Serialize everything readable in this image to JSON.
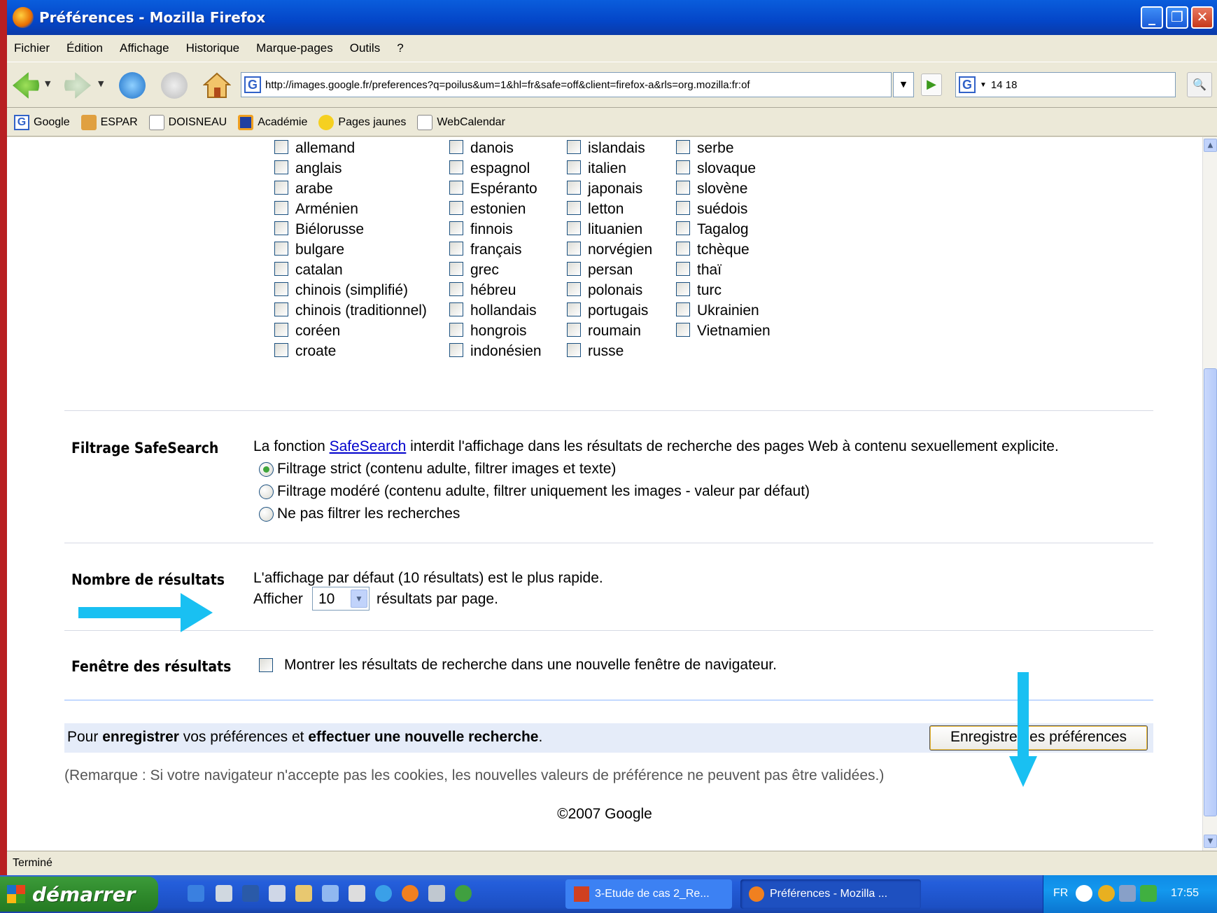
{
  "window": {
    "title": "Préférences - Mozilla Firefox"
  },
  "menu": [
    "Fichier",
    "Édition",
    "Affichage",
    "Historique",
    "Marque-pages",
    "Outils",
    "?"
  ],
  "nav": {
    "url": "http://images.google.fr/preferences?q=poilus&um=1&hl=fr&safe=off&client=firefox-a&rls=org.mozilla:fr:of",
    "search_value": "14 18"
  },
  "bookmarks": [
    "Google",
    "ESPAR",
    "DOISNEAU",
    "Académie",
    "Pages jaunes",
    "WebCalendar"
  ],
  "languages": {
    "col1": [
      "allemand",
      "anglais",
      "arabe",
      "Arménien",
      "Biélorusse",
      "bulgare",
      "catalan",
      "chinois (simplifié)",
      "chinois (traditionnel)",
      "coréen",
      "croate"
    ],
    "col2": [
      "danois",
      "espagnol",
      "Espéranto",
      "estonien",
      "finnois",
      "français",
      "grec",
      "hébreu",
      "hollandais",
      "hongrois",
      "indonésien"
    ],
    "col3": [
      "islandais",
      "italien",
      "japonais",
      "letton",
      "lituanien",
      "norvégien",
      "persan",
      "polonais",
      "portugais",
      "roumain",
      "russe"
    ],
    "col4": [
      "serbe",
      "slovaque",
      "slovène",
      "suédois",
      "Tagalog",
      "tchèque",
      "thaï",
      "turc",
      "Ukrainien",
      "Vietnamien"
    ]
  },
  "safesearch": {
    "label": "Filtrage SafeSearch",
    "desc_pre": "La fonction ",
    "desc_link": "SafeSearch",
    "desc_post": " interdit l'affichage dans les résultats de recherche des pages Web à contenu sexuellement explicite.",
    "options": [
      "Filtrage strict (contenu adulte, filtrer images et texte)",
      "Filtrage modéré (contenu adulte, filtrer uniquement les images - valeur par défaut)",
      "Ne pas filtrer les recherches"
    ],
    "selected_index": 0
  },
  "results": {
    "label": "Nombre de résultats",
    "desc": "L'affichage par défaut (10 résultats) est le plus rapide.",
    "show_pre": "Afficher",
    "value": "10",
    "show_post": "résultats par page."
  },
  "window_pref": {
    "label": "Fenêtre des résultats",
    "text": "Montrer les résultats de recherche dans une nouvelle fenêtre de navigateur."
  },
  "save": {
    "t1": "Pour ",
    "t2": "enregistrer",
    "t3": " vos préférences et ",
    "t4": "effectuer une nouvelle recherche",
    "t5": ".",
    "button": "Enregistrer les préférences"
  },
  "note": "(Remarque : Si votre navigateur n'accepte pas les cookies, les nouvelles valeurs de préférence ne peuvent pas être validées.)",
  "footer": "©2007 Google",
  "status": "Terminé",
  "taskbar": {
    "start": "démarrer",
    "tasks": [
      "3-Etude de cas 2_Re...",
      "Préférences - Mozilla ..."
    ],
    "lang": "FR",
    "clock": "17:55"
  },
  "colors": {
    "arrow": "#19c0f2",
    "titlebar": "#0a5ddc",
    "slide_bg": "#a3161b"
  }
}
